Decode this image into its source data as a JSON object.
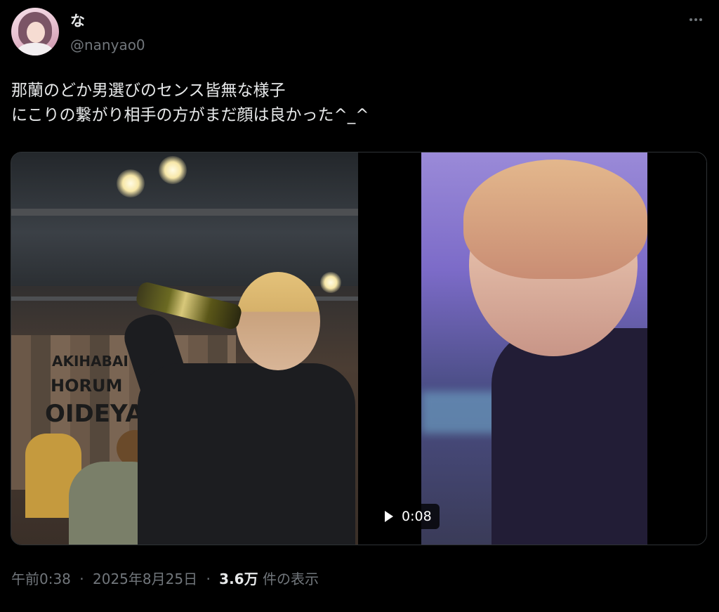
{
  "author": {
    "display_name": "な",
    "handle": "@nanyao0"
  },
  "tweet": {
    "line1": "那蘭のどか男選びのセンス皆無な様子",
    "line2": "にこりの繋がり相手の方がまだ顔は良かった^_^"
  },
  "media": {
    "photo_sign": {
      "line1": "AKIHABAI",
      "line2": "HORUM",
      "line3": "OIDEYA"
    },
    "video_duration": "0:08"
  },
  "meta": {
    "time": "午前0:38",
    "separator": "·",
    "date": "2025年8月25日",
    "views_count": "3.6万",
    "views_label": "件の表示"
  },
  "icons": {
    "more": "more-horizontal-icon",
    "play": "play-icon"
  },
  "colors": {
    "background": "#000000",
    "text_primary": "#e7e9ea",
    "text_secondary": "#71767b",
    "border": "#2f3336"
  }
}
